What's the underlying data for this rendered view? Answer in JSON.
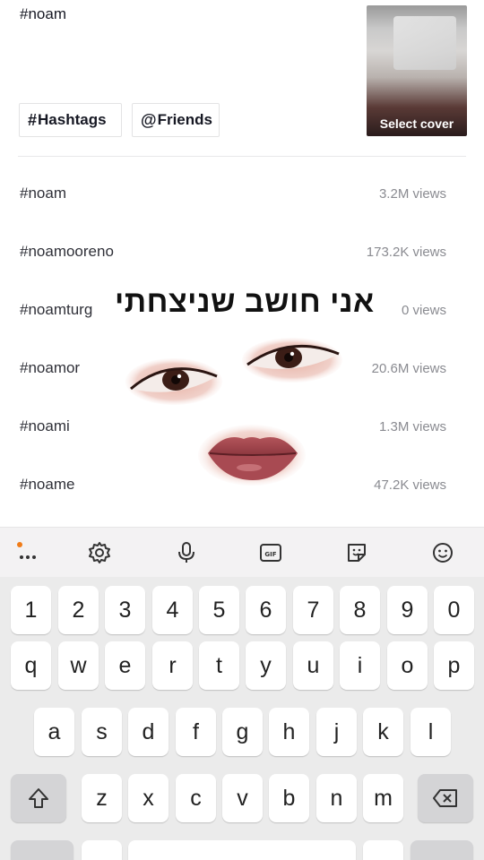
{
  "post": {
    "caption": "#noam",
    "cover_label": "Select cover"
  },
  "chips": [
    {
      "glyph": "#",
      "label": "Hashtags"
    },
    {
      "glyph": "@",
      "label": "Friends"
    }
  ],
  "suggestions": [
    {
      "tag": "#noam",
      "views": "3.2M views"
    },
    {
      "tag": "#noamooreno",
      "views": "173.2K views"
    },
    {
      "tag": "#noamturg",
      "views": "0 views"
    },
    {
      "tag": "#noamor",
      "views": "20.6M views"
    },
    {
      "tag": "#noami",
      "views": "1.3M views"
    },
    {
      "tag": "#noame",
      "views": "47.2K views"
    }
  ],
  "overlay": {
    "text": "אני חושב שניצחתי"
  },
  "keyboard": {
    "toolbar_icons": [
      "more-dots-icon",
      "settings-icon",
      "microphone-icon",
      "gif-icon",
      "sticker-icon",
      "emoji-icon"
    ],
    "number_row": [
      "1",
      "2",
      "3",
      "4",
      "5",
      "6",
      "7",
      "8",
      "9",
      "0"
    ],
    "row_1": [
      "q",
      "w",
      "e",
      "r",
      "t",
      "y",
      "u",
      "i",
      "o",
      "p"
    ],
    "row_2": [
      "a",
      "s",
      "d",
      "f",
      "g",
      "h",
      "j",
      "k",
      "l"
    ],
    "row_3": [
      "z",
      "x",
      "c",
      "v",
      "b",
      "n",
      "m"
    ]
  },
  "colors": {
    "accent_dot": "#f07c18",
    "text_primary": "#161823",
    "text_secondary": "#8a8b91"
  }
}
